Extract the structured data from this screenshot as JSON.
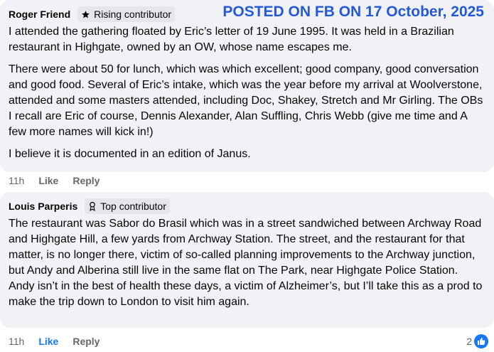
{
  "stamp": "POSTED ON FB ON 17 October, 2025",
  "comments": [
    {
      "author": "Roger Friend",
      "badge_icon": "star-icon",
      "badge": "Rising contributor",
      "paragraphs": [
        "I attended the gathering floated by Eric’s letter of 19 June 1995. It was held in a Brazilian restaurant in Highgate, owned by an OW, whose name escapes me.",
        "There were about 50 for lunch, which was which excellent; good company, good conversation and good food. Several of Eric’s intake, which was the year before my arrival at Woolverstone, attended and some masters attended, including Doc, Shakey, Stretch and Mr Girling. The OBs I recall are Eric of course, Dennis Alexander, Alan Suffling, Chris Webb (give me time and A few more names will kick in!)",
        "I believe it is documented in an edition of Janus."
      ],
      "time": "11h",
      "like": "Like",
      "reply": "Reply"
    },
    {
      "author": "Louis Parperis",
      "badge_icon": "award-ribbon-icon",
      "badge": "Top contributor",
      "paragraphs": [
        "The restaurant was Sabor do Brasil which was in a street sandwiched between Archway Road and Highgate Hill, a few yards from Archway Station. The street, and the restaurant for that matter, is no longer there, victim of so-called planning improvements to the Archway junction, but Andy and Alberina still live in the same flat on The Park, near Highgate Police Station. Andy isn’t in the best of health these days, a victim of Alzheimer’s, but I’ll take this as a prod to make the trip down to London to visit him again."
      ],
      "time": "11h",
      "like": "Like",
      "reply": "Reply",
      "reaction_count": "2",
      "reaction_icon": "thumbs-up-icon",
      "liked_color": "#1877f2"
    }
  ]
}
